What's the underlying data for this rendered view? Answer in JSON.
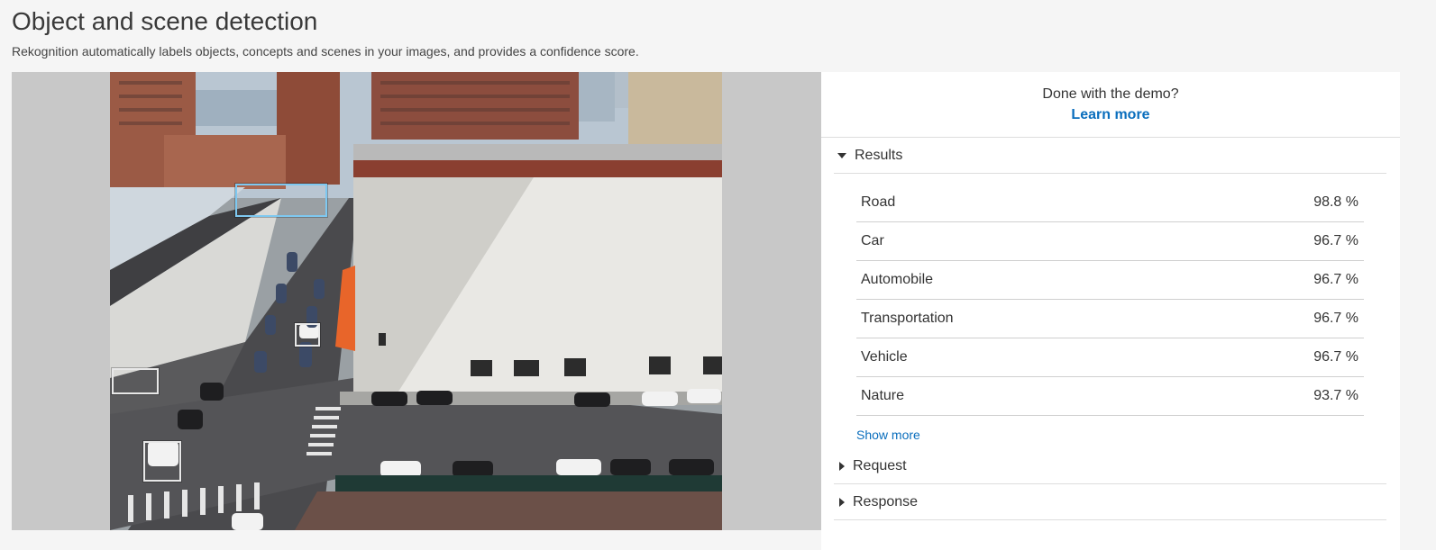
{
  "page": {
    "title": "Object and scene detection",
    "subtitle": "Rekognition automatically labels objects, concepts and scenes in your images, and provides a confidence score."
  },
  "demo": {
    "question": "Done with the demo?",
    "learn_more": "Learn more"
  },
  "results": {
    "section_label": "Results",
    "expanded": true,
    "items": [
      {
        "label": "Road",
        "confidence": "98.8 %"
      },
      {
        "label": "Car",
        "confidence": "96.7 %"
      },
      {
        "label": "Automobile",
        "confidence": "96.7 %"
      },
      {
        "label": "Transportation",
        "confidence": "96.7 %"
      },
      {
        "label": "Vehicle",
        "confidence": "96.7 %"
      },
      {
        "label": "Nature",
        "confidence": "93.7 %"
      }
    ],
    "show_more": "Show more"
  },
  "request": {
    "section_label": "Request",
    "expanded": false
  },
  "response": {
    "section_label": "Response",
    "expanded": false
  },
  "colors": {
    "link": "#0a6ebd",
    "selected_box": "#7ec8f0",
    "box": "#e8e8e8"
  }
}
